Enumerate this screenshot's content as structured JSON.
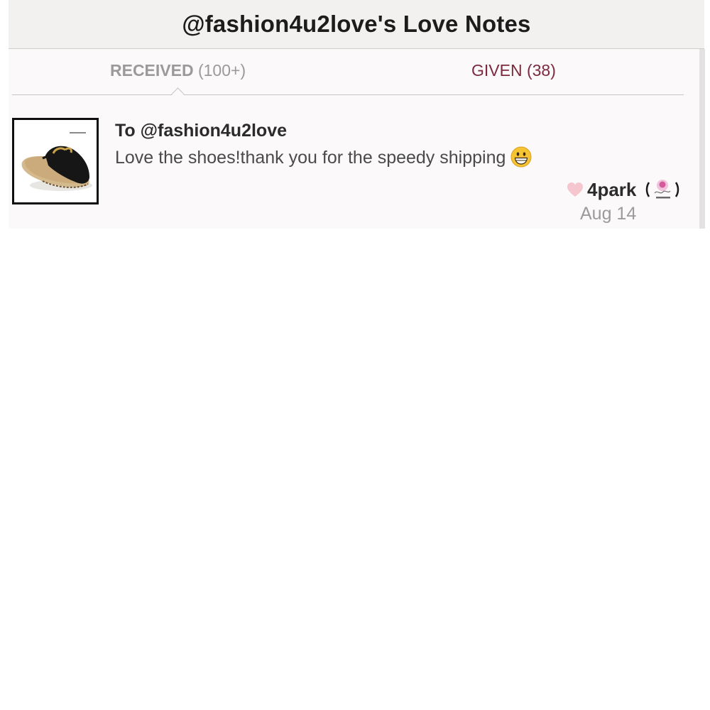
{
  "header": {
    "title": "@fashion4u2love's Love Notes"
  },
  "tabs": {
    "received": {
      "label": "RECEIVED",
      "count": "(100+)"
    },
    "given": {
      "label": "GIVEN (38)"
    }
  },
  "notes": [
    {
      "recipient": "To @fashion4u2love",
      "message": "Love the shoes!thank you for the speedy shipping",
      "emoji": "grinning-face-icon",
      "author": "4park",
      "date": "Aug 14",
      "thumbnail": "black-mule-shoe-image",
      "avatar": "little-rose-boutique-logo",
      "heart_icon": "heart-icon"
    }
  ],
  "colors": {
    "header_bg": "#f3f1ef",
    "given_tab": "#7c2a3f",
    "received_tab": "#9a9a9a",
    "heart": "#f6c6cf"
  }
}
